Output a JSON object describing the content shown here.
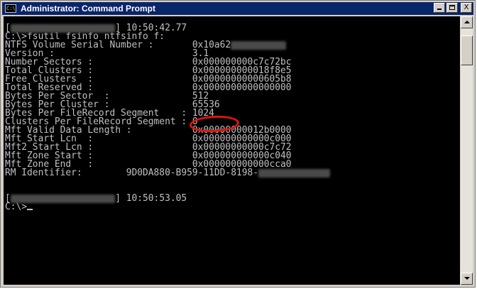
{
  "window": {
    "title": "Administrator: Command Prompt",
    "app_icon": "cmd-icon",
    "app_icon_text": "C:\\",
    "controls": {
      "minimize_icon": "minimize-icon",
      "maximize_icon": "maximize-icon",
      "close_icon": "close-icon",
      "close_glyph": "X"
    }
  },
  "highlight_color": "#e0140f",
  "console": {
    "lines": [
      {
        "prefix": "[",
        "redacted": "PRIVATEMACHINE\\user",
        "suffix": "] 10:50:42.77"
      },
      {
        "text": "C:\\>fsutil fsinfo ntfsinfo f:"
      },
      {
        "text": "NTFS Volume Serial Number :       0x10a62",
        "redacted": "bb5a62bda8"
      },
      {
        "text": "Version :                         3.1"
      },
      {
        "text": "Number Sectors :                  0x000000000c7c72bc"
      },
      {
        "text": "Total Clusters :                  0x000000000018f8e5"
      },
      {
        "text": "Free Clusters  :                  0x00000000000605b8"
      },
      {
        "text": "Total Reserved :                  0x0000000000000000"
      },
      {
        "text": "Bytes Per Sector  :               512"
      },
      {
        "text": "Bytes Per Cluster :               65536"
      },
      {
        "text": "Bytes Per FileRecord Segment    : 1024"
      },
      {
        "text": "Clusters Per FileRecord Segment : 0"
      },
      {
        "text": "Mft Valid Data Length :           0x00000000012b0000"
      },
      {
        "text": "Mft Start Lcn  :                  0x000000000000c000"
      },
      {
        "text": "Mft2 Start Lcn :                  0x00000000000c7c72"
      },
      {
        "text": "Mft Zone Start :                  0x000000000000c040"
      },
      {
        "text": "Mft Zone End   :                  0x000000000000cca0"
      },
      {
        "text": "RM Identifier:        9D0DA880-B959-11DD-8198-",
        "redacted": "0000000000000"
      },
      {
        "text": ""
      },
      {
        "text": ""
      },
      {
        "prefix": "[",
        "redacted": "PRIVATEMACHINE\\user",
        "suffix": "] 10:50:53.05"
      },
      {
        "text": "C:\\>",
        "cursor": true
      }
    ]
  },
  "scrollbar": {
    "up_icon": "scroll-up-arrow-icon",
    "down_icon": "scroll-down-arrow-icon",
    "position_fraction": 0.03,
    "thumb_fraction": 0.12
  }
}
